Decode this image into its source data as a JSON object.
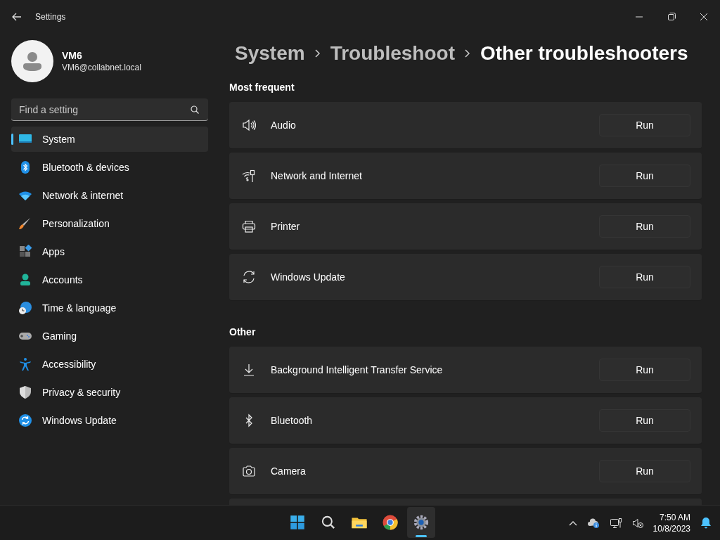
{
  "window": {
    "title": "Settings"
  },
  "account": {
    "name": "VM6",
    "email": "VM6@collabnet.local"
  },
  "search": {
    "placeholder": "Find a setting"
  },
  "sidebar": {
    "items": [
      {
        "label": "System",
        "selected": true
      },
      {
        "label": "Bluetooth & devices",
        "selected": false
      },
      {
        "label": "Network & internet",
        "selected": false
      },
      {
        "label": "Personalization",
        "selected": false
      },
      {
        "label": "Apps",
        "selected": false
      },
      {
        "label": "Accounts",
        "selected": false
      },
      {
        "label": "Time & language",
        "selected": false
      },
      {
        "label": "Gaming",
        "selected": false
      },
      {
        "label": "Accessibility",
        "selected": false
      },
      {
        "label": "Privacy & security",
        "selected": false
      },
      {
        "label": "Windows Update",
        "selected": false
      }
    ]
  },
  "breadcrumb": [
    "System",
    "Troubleshoot",
    "Other troubleshooters"
  ],
  "sections": [
    {
      "title": "Most frequent",
      "items": [
        {
          "kind": "audio",
          "label": "Audio",
          "button": "Run"
        },
        {
          "kind": "network",
          "label": "Network and Internet",
          "button": "Run"
        },
        {
          "kind": "printer",
          "label": "Printer",
          "button": "Run"
        },
        {
          "kind": "update",
          "label": "Windows Update",
          "button": "Run"
        }
      ]
    },
    {
      "title": "Other",
      "items": [
        {
          "kind": "download",
          "label": "Background Intelligent Transfer Service",
          "button": "Run"
        },
        {
          "kind": "bluetooth",
          "label": "Bluetooth",
          "button": "Run"
        },
        {
          "kind": "camera",
          "label": "Camera",
          "button": "Run"
        }
      ]
    }
  ],
  "taskbar": {
    "apps": [
      {
        "kind": "start",
        "selected": false
      },
      {
        "kind": "search",
        "selected": false
      },
      {
        "kind": "files",
        "selected": false
      },
      {
        "kind": "browser",
        "selected": false
      },
      {
        "kind": "settings",
        "selected": true
      }
    ],
    "time": "7:50 AM",
    "date": "10/8/2023"
  }
}
